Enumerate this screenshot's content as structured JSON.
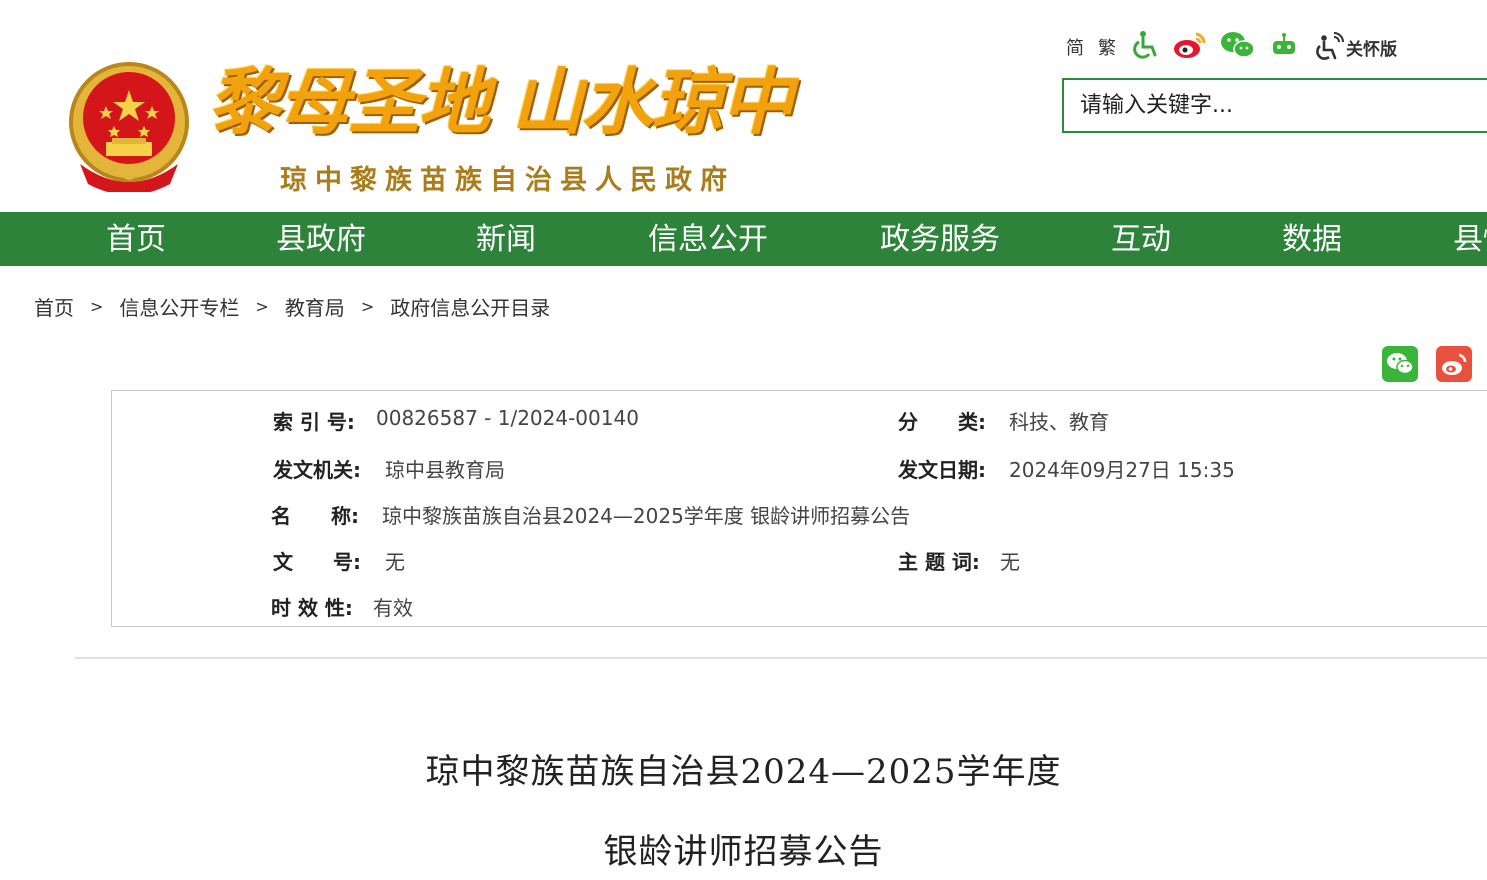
{
  "header": {
    "slogan": "黎母圣地 山水琼中",
    "gov_name": "琼中黎族苗族自治县人民政府",
    "tools": {
      "simplified": "简",
      "traditional": "繁",
      "accessibility_icon": "accessibility-icon",
      "weibo_icon": "weibo-icon",
      "wechat_icon": "wechat-icon",
      "robot_icon": "robot-icon",
      "elder_mode_label": "关怀版"
    },
    "search": {
      "placeholder": "请输入关键字..."
    }
  },
  "nav": {
    "items": [
      "首页",
      "县政府",
      "新闻",
      "信息公开",
      "政务服务",
      "互动",
      "数据",
      "县情"
    ]
  },
  "breadcrumb": {
    "items": [
      "首页",
      "信息公开专栏",
      "教育局",
      "政府信息公开目录"
    ],
    "separator": ">"
  },
  "share": {
    "wechat_color": "#3ab53a",
    "weibo_color": "#e8513e"
  },
  "info": {
    "index_label": "索 引 号:",
    "index_value": "00826587 - 1/2024-00140",
    "category_label": "分　　类:",
    "category_value": "科技、教育",
    "issuer_label": "发文机关:",
    "issuer_value": "琼中县教育局",
    "date_label": "发文日期:",
    "date_value": "2024年09月27日 15:35",
    "name_label": "名　　称:",
    "name_value": "琼中黎族苗族自治县2024—2025学年度 银龄讲师招募公告",
    "docno_label": "文　　号:",
    "docno_value": "无",
    "keywords_label": "主 题 词:",
    "keywords_value": "无",
    "validity_label": "时 效 性:",
    "validity_value": "有效"
  },
  "article": {
    "title_line1": "琼中黎族苗族自治县2024—2025学年度",
    "title_line2": "银龄讲师招募公告"
  },
  "colors": {
    "nav_green": "#2c8339",
    "logo_gold": "#f2a20c",
    "emblem_red": "#d4161b"
  }
}
